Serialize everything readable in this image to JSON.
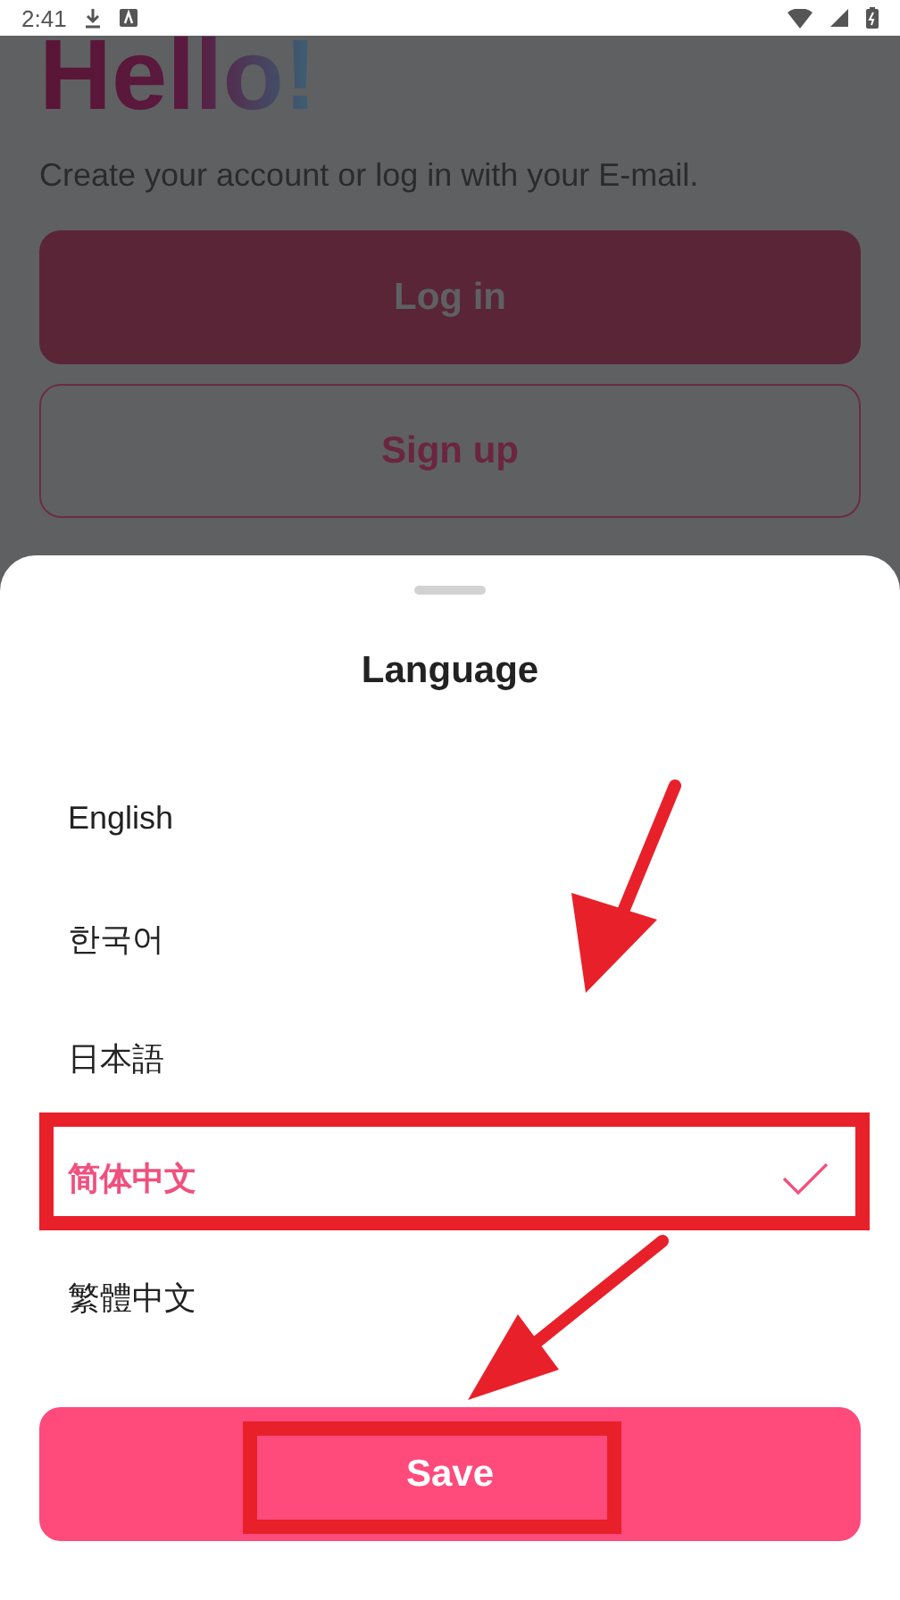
{
  "status_bar": {
    "time": "2:41"
  },
  "background": {
    "title": "Hello!",
    "subtitle": "Create your account or log in with your E-mail.",
    "buttons": [
      {
        "label": "Log in",
        "kind": "filled"
      },
      {
        "label": "Sign up",
        "kind": "outlined"
      }
    ]
  },
  "sheet": {
    "title": "Language",
    "languages": [
      {
        "label": "English",
        "selected": false
      },
      {
        "label": "한국어",
        "selected": false
      },
      {
        "label": "日本語",
        "selected": false
      },
      {
        "label": "简体中文",
        "selected": true
      },
      {
        "label": "繁體中文",
        "selected": false
      }
    ],
    "save_button": "Save"
  }
}
